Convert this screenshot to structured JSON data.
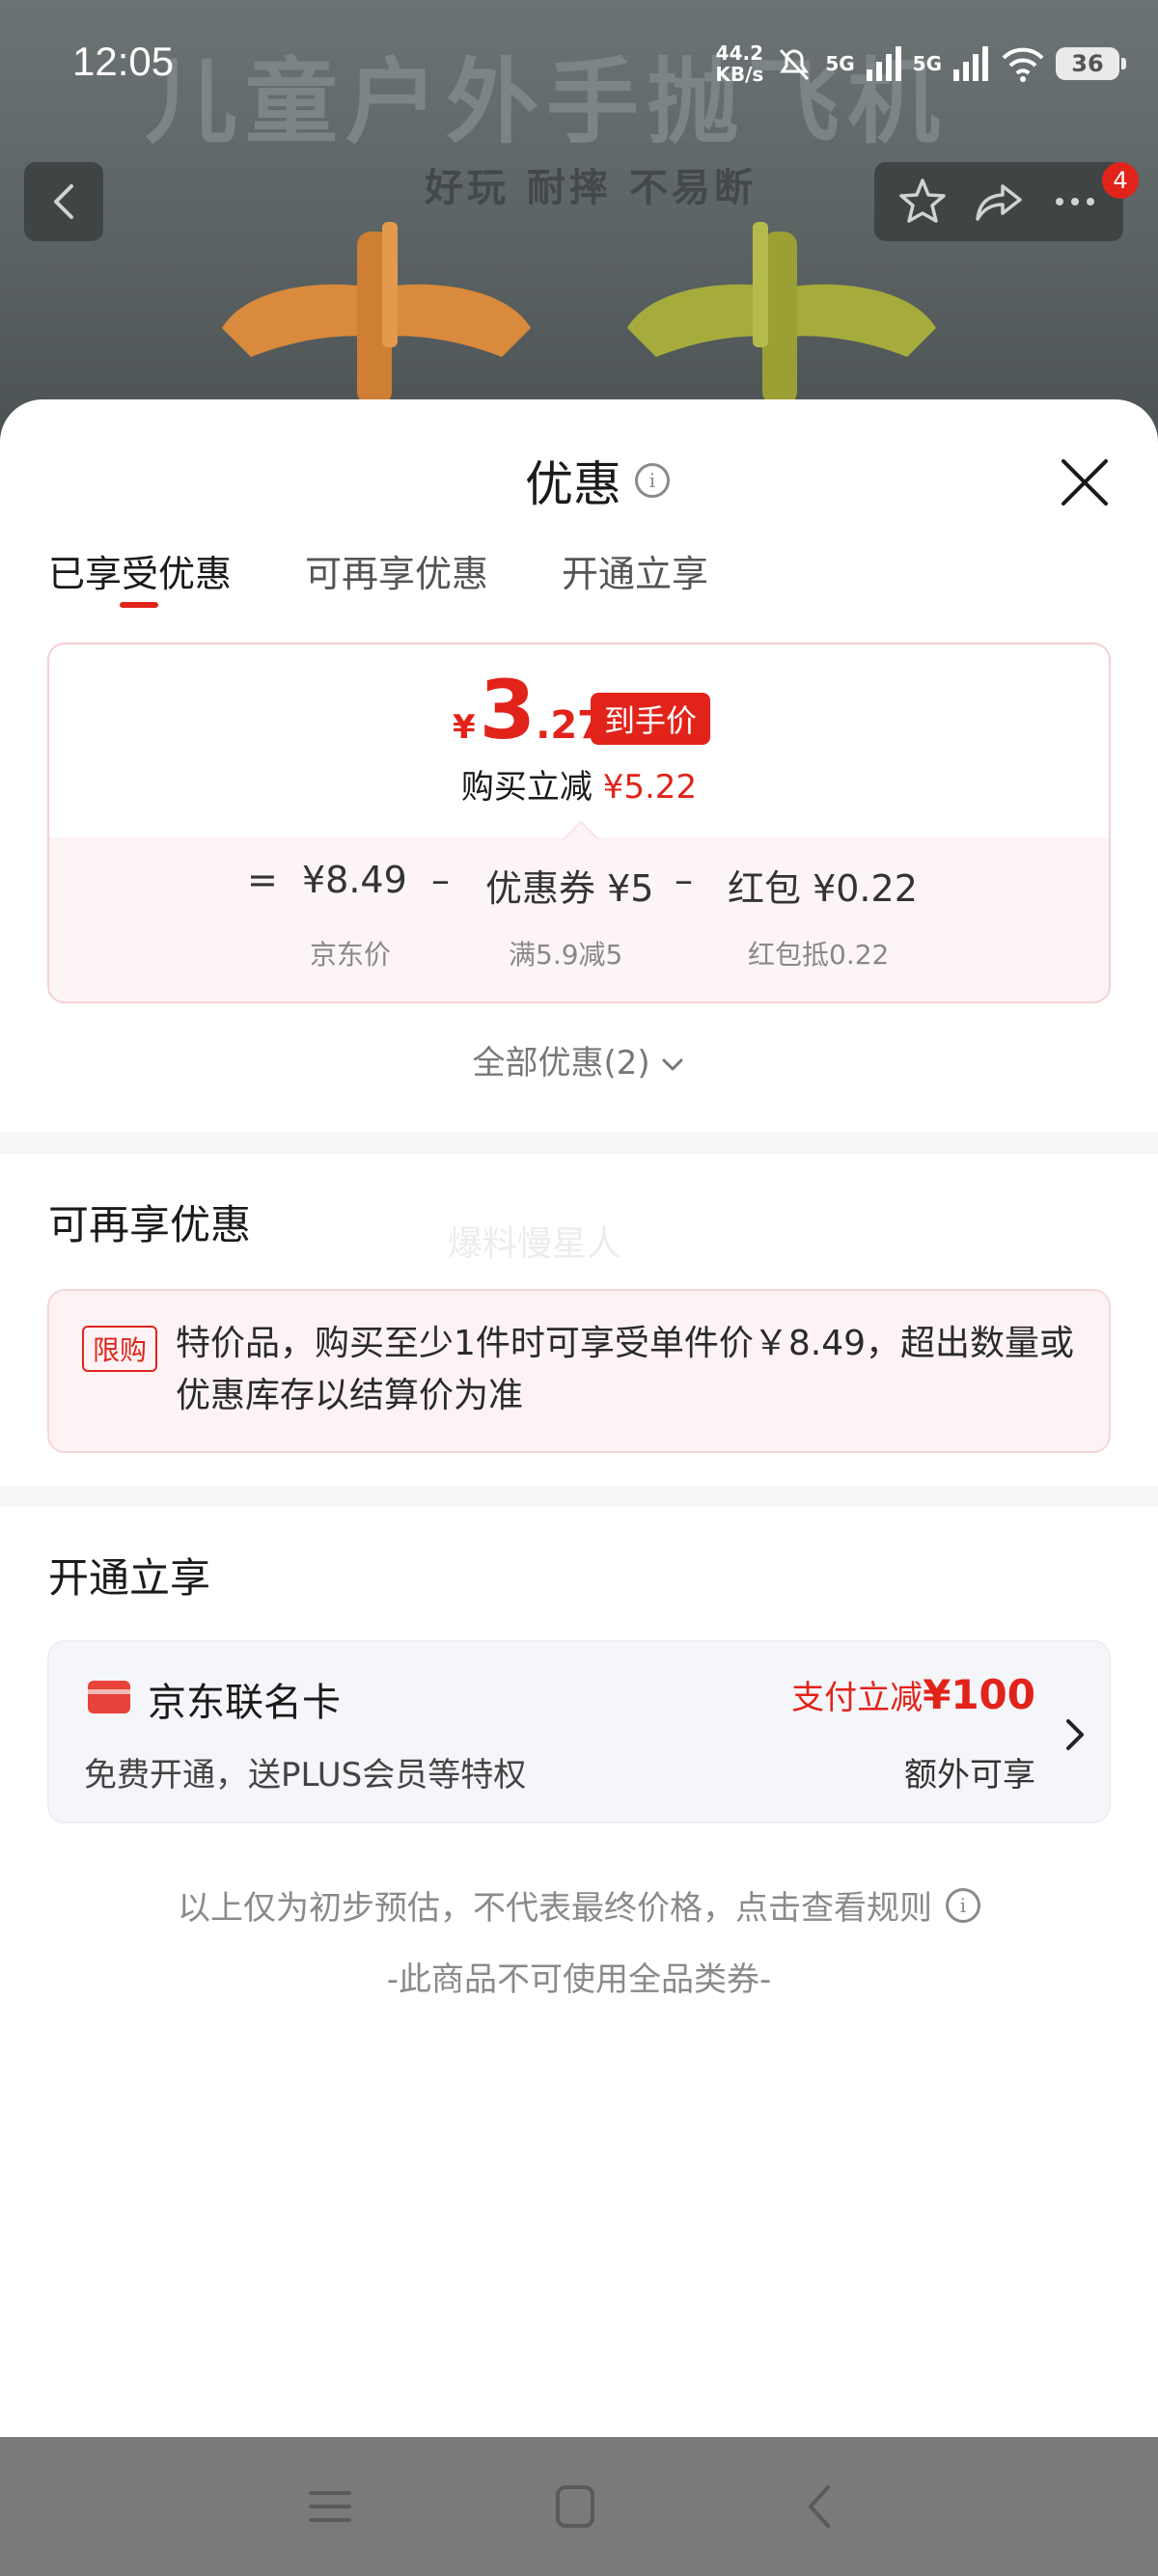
{
  "status_bar": {
    "time": "12:05",
    "net_speed": "44.2",
    "net_unit": "KB/s",
    "signal_1": "5G",
    "signal_2": "5G",
    "battery": "36"
  },
  "banner": {
    "title": "儿童户外手抛飞机",
    "subtitle": "好玩 耐摔 不易断",
    "cart_badge": "4"
  },
  "sheet": {
    "title": "优惠",
    "tabs": [
      {
        "label": "已享受优惠",
        "active": true
      },
      {
        "label": "可再享优惠",
        "active": false
      },
      {
        "label": "开通立享",
        "active": false
      }
    ]
  },
  "price_card": {
    "currency": "¥",
    "price_int": "3",
    "price_dec": ".27",
    "price_tag": "到手价",
    "reduce_label": "购买立减",
    "reduce_value": "¥5.22",
    "formula": {
      "equals": "=",
      "base_value": "¥8.49",
      "minus_1": "–",
      "coupon_value": "优惠券 ¥5",
      "minus_2": "–",
      "redpacket_value": "红包 ¥0.22",
      "base_label": "京东价",
      "coupon_label": "满5.9减5",
      "redpacket_label": "红包抵0.22"
    }
  },
  "all_discounts": "全部优惠(2)",
  "extra_section": {
    "title": "可再享优惠",
    "watermark": "爆料慢星人",
    "limit_tag": "限购",
    "limit_text": "特价品，购买至少1件时可享受单件价￥8.49，超出数量或优惠库存以结算价为准"
  },
  "open_section": {
    "title": "开通立享",
    "card_name": "京东联名卡",
    "card_desc": "免费开通，送PLUS会员等特权",
    "promo_label": "支付立减",
    "promo_value": "¥100",
    "promo_extra": "额外可享"
  },
  "footer": {
    "note": "以上仅为初步预估，不代表最终价格，点击查看规则",
    "note2": "-此商品不可使用全品类券-"
  },
  "colors": {
    "accent_red": "#e2231a",
    "card_pink_bg": "#fdf3f4",
    "card_grey_bg": "#f5f6fa"
  },
  "icons": [
    "back-arrow-icon",
    "star-icon",
    "share-icon",
    "more-icon",
    "info-icon",
    "close-icon",
    "chevron-down-icon",
    "card-icon",
    "chevron-right-icon",
    "menu-icon",
    "home-icon",
    "back-icon"
  ]
}
